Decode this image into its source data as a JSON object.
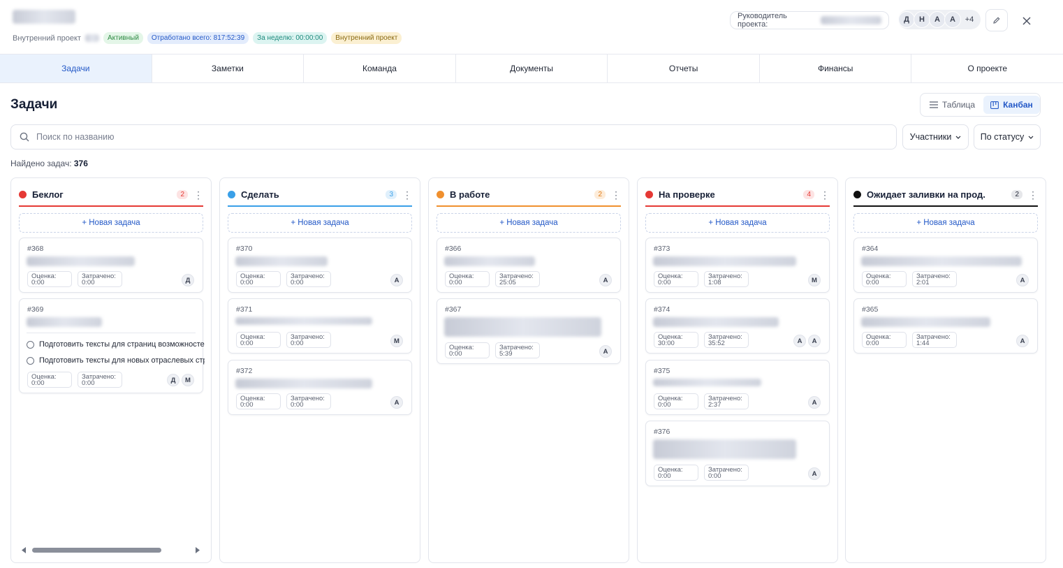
{
  "header": {
    "project_sub": "Внутренний проект",
    "chips": [
      "Активный",
      "Отработано всего: 817:52:39",
      "За неделю: 00:00:00",
      "Внутренний проект"
    ],
    "lead_label": "Руководитель проекта:",
    "avatars": [
      "Д",
      "Н",
      "А",
      "А"
    ],
    "more": "+4",
    "edit_icon": "pencil-icon",
    "close_icon": "close-icon"
  },
  "tabs": [
    "Задачи",
    "Заметки",
    "Команда",
    "Документы",
    "Отчеты",
    "Финансы",
    "О проекте"
  ],
  "active_tab": "Задачи",
  "page_title": "Задачи",
  "view_toggle": {
    "table": "Таблица",
    "kanban": "Канбан",
    "selected": "Канбан"
  },
  "search": {
    "placeholder": "Поиск по названию",
    "value": ""
  },
  "filters": {
    "members": "Участники",
    "status": "По статусу"
  },
  "found": {
    "label": "Найдено задач:",
    "count": "376"
  },
  "new_task": "+ Новая задача",
  "est_label": "Оценка:",
  "spent_label": "Затрачено:",
  "columns": [
    {
      "name": "Беклог",
      "count": "2",
      "color": "#e53935",
      "cards": [
        {
          "num": "#368",
          "est": "0:00",
          "spent": "0:00",
          "users": [
            "Д"
          ]
        },
        {
          "num": "#369",
          "est": "0:00",
          "spent": "0:00",
          "users": [
            "Д",
            "М"
          ],
          "checklist": [
            "Подготовить тексты для страниц возможностей",
            "Подготовить тексты для новых отраслевых страниц"
          ]
        }
      ]
    },
    {
      "name": "Сделать",
      "count": "3",
      "color": "#3aa0e8",
      "cards": [
        {
          "num": "#370",
          "est": "0:00",
          "spent": "0:00",
          "users": [
            "А"
          ]
        },
        {
          "num": "#371",
          "est": "0:00",
          "spent": "0:00",
          "users": [
            "М"
          ]
        },
        {
          "num": "#372",
          "est": "0:00",
          "spent": "0:00",
          "users": [
            "А"
          ]
        }
      ]
    },
    {
      "name": "В работе",
      "count": "2",
      "color": "#f0902e",
      "cards": [
        {
          "num": "#366",
          "est": "0:00",
          "spent": "25:05",
          "users": [
            "А"
          ]
        },
        {
          "num": "#367",
          "est": "0:00",
          "spent": "5:39",
          "users": [
            "А"
          ]
        }
      ]
    },
    {
      "name": "На проверке",
      "count": "4",
      "color": "#e53935",
      "cards": [
        {
          "num": "#373",
          "est": "0:00",
          "spent": "1:08",
          "users": [
            "М"
          ]
        },
        {
          "num": "#374",
          "est": "30:00",
          "spent": "35:52",
          "users": [
            "А",
            "А"
          ]
        },
        {
          "num": "#375",
          "est": "0:00",
          "spent": "2:37",
          "users": [
            "А"
          ]
        },
        {
          "num": "#376",
          "est": "0:00",
          "spent": "0:00",
          "users": [
            "А"
          ]
        }
      ]
    },
    {
      "name": "Ожидает заливки на прод.",
      "count": "2",
      "color": "#111111",
      "cards": [
        {
          "num": "#364",
          "est": "0:00",
          "spent": "2:01",
          "users": [
            "А"
          ]
        },
        {
          "num": "#365",
          "est": "0:00",
          "spent": "1:44",
          "users": [
            "А"
          ]
        }
      ]
    }
  ]
}
